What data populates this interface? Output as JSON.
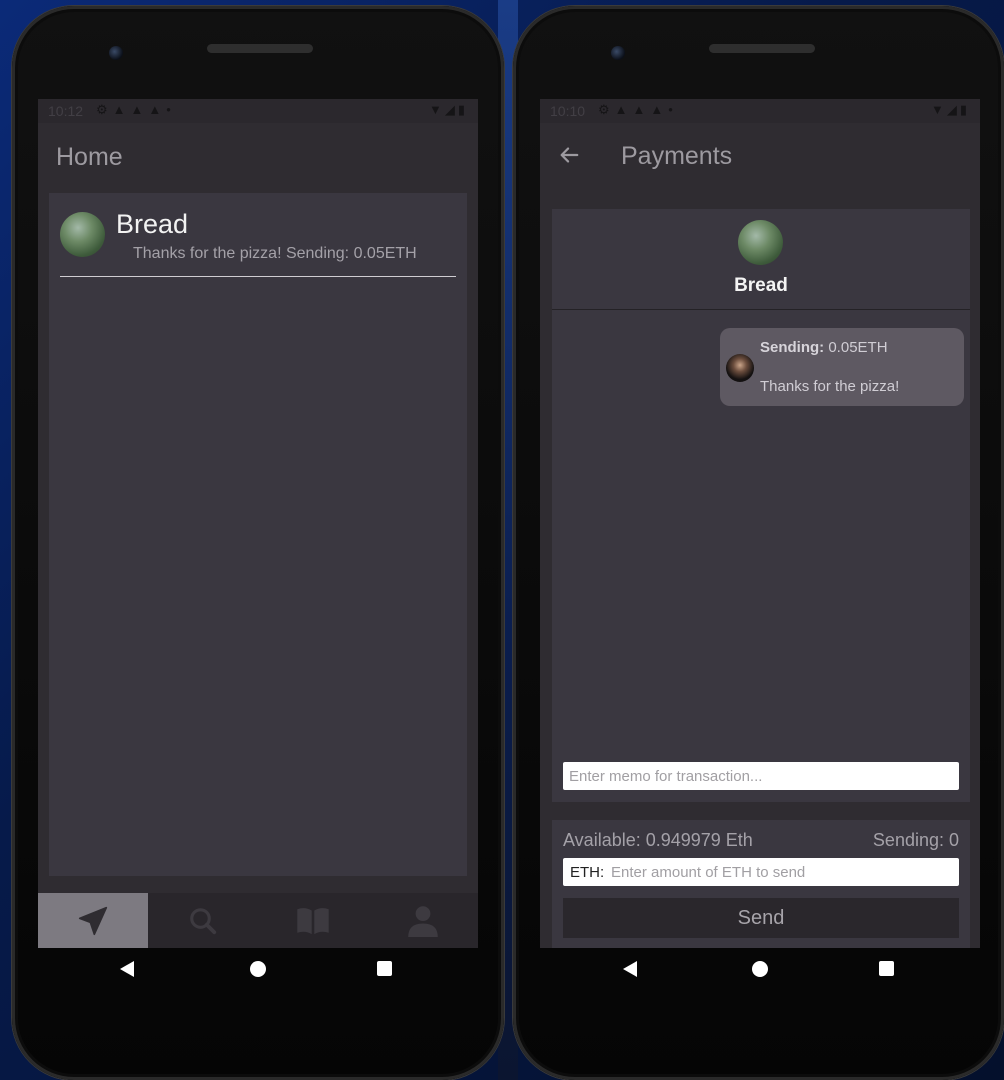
{
  "home_phone": {
    "status_time": "10:12",
    "app_title": "Home",
    "contacts": [
      {
        "name": "Bread",
        "preview": "Thanks for the pizza! Sending: 0.05ETH"
      }
    ],
    "bottom_nav": [
      {
        "icon": "send-icon",
        "active": true
      },
      {
        "icon": "search-icon",
        "active": false
      },
      {
        "icon": "book-icon",
        "active": false
      },
      {
        "icon": "person-icon",
        "active": false
      }
    ]
  },
  "payments_phone": {
    "status_time": "10:10",
    "app_title": "Payments",
    "recipient_name": "Bread",
    "message": {
      "sending_label": "Sending:",
      "sending_amount": "0.05ETH",
      "memo": "Thanks for the pizza!"
    },
    "memo_placeholder": "Enter memo for transaction...",
    "available": "Available: 0.949979 Eth",
    "sending_count": "Sending: 0",
    "eth_prefix": "ETH:",
    "eth_placeholder": "Enter amount of ETH to send",
    "send_label": "Send"
  },
  "colors": {
    "screen_bg": "#2f2c31",
    "card_bg": "#3a3740",
    "bubble_bg": "#5e5962",
    "active_nav": "#7d7a81"
  }
}
